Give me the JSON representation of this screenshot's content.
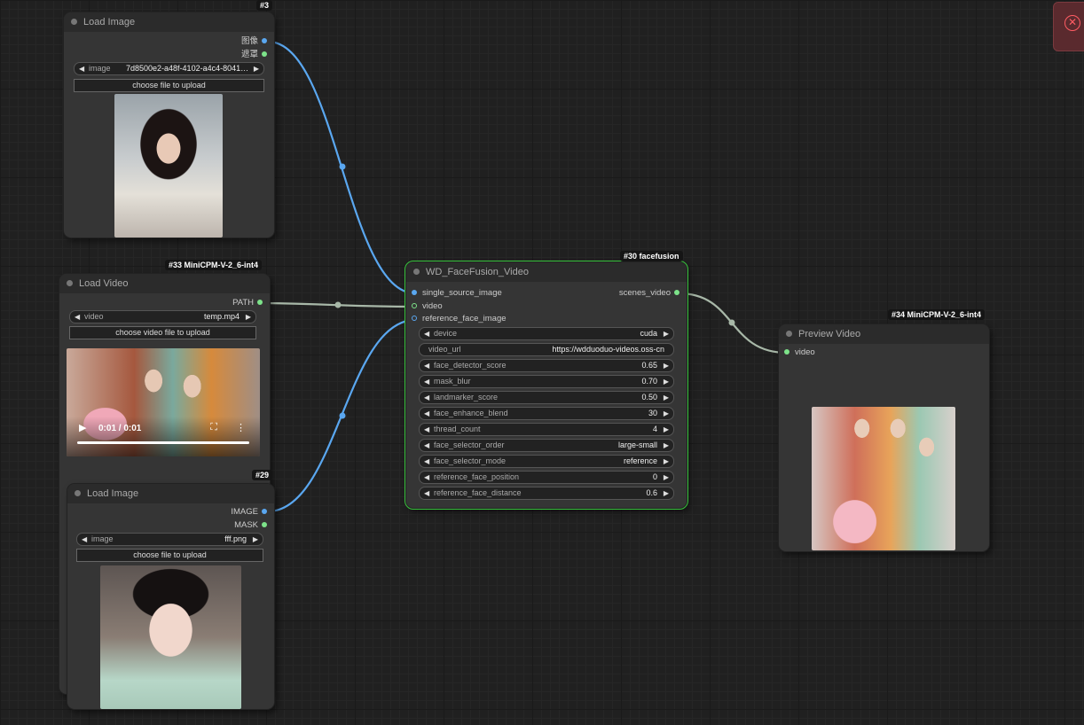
{
  "nodes": {
    "load_image_1": {
      "id_tag": "#3",
      "title": "Load Image",
      "outputs": [
        "图像",
        "遮罩"
      ],
      "widget_name": "image",
      "widget_value": "7d8500e2-a48f-4102-a4c4-8041b...",
      "upload_label": "choose file to upload"
    },
    "load_video": {
      "id_tag": "#33 MiniCPM-V-2_6-int4",
      "title": "Load Video",
      "output": "PATH",
      "widget_name": "video",
      "widget_value": "temp.mp4",
      "upload_label": "choose video file to upload",
      "player_time": "0:01 / 0:01"
    },
    "load_image_2": {
      "id_tag": "#29",
      "title": "Load Image",
      "outputs": [
        "IMAGE",
        "MASK"
      ],
      "widget_name": "image",
      "widget_value": "fff.png",
      "upload_label": "choose file to upload"
    },
    "facefusion": {
      "id_tag": "#30 facefusion",
      "title": "WD_FaceFusion_Video",
      "inputs": [
        "single_source_image",
        "video",
        "reference_face_image"
      ],
      "output": "scenes_video",
      "widgets": [
        {
          "name": "device",
          "value": "cuda"
        },
        {
          "name": "video_url",
          "value": "https://wdduoduo-videos.oss-cn"
        },
        {
          "name": "face_detector_score",
          "value": "0.65"
        },
        {
          "name": "mask_blur",
          "value": "0.70"
        },
        {
          "name": "landmarker_score",
          "value": "0.50"
        },
        {
          "name": "face_enhance_blend",
          "value": "30"
        },
        {
          "name": "thread_count",
          "value": "4"
        },
        {
          "name": "face_selector_order",
          "value": "large-small"
        },
        {
          "name": "face_selector_mode",
          "value": "reference"
        },
        {
          "name": "reference_face_position",
          "value": "0"
        },
        {
          "name": "reference_face_distance",
          "value": "0.6"
        }
      ]
    },
    "preview_video": {
      "id_tag": "#34 MiniCPM-V-2_6-int4",
      "title": "Preview Video",
      "input": "video"
    }
  },
  "colors": {
    "image_link": "#5aa7f0",
    "video_link": "#a8b8a8",
    "selected_border": "#39c43e",
    "node_bg": "#353535",
    "canvas_bg": "#202020"
  },
  "icons": [
    "play-icon",
    "fullscreen-icon",
    "more-vert-icon",
    "close-circle-icon",
    "arrow-left-icon",
    "arrow-right-icon"
  ]
}
